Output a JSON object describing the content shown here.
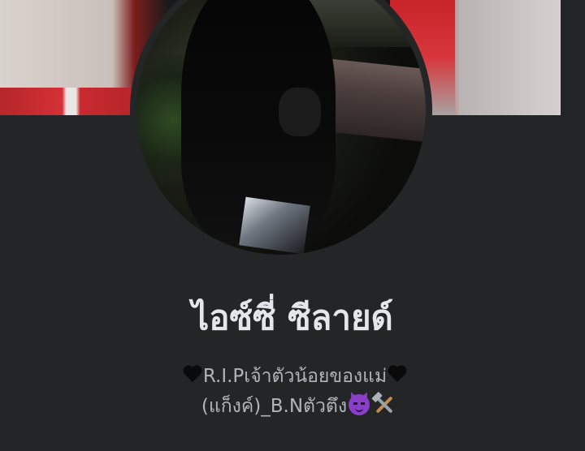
{
  "profile": {
    "name": "ไอซ์ซี่ ซีลายด์",
    "bio_line1": "R.I.Pเจ้าตัวน้อยของแม่",
    "bio_line2": "(แก็งค์)_B.Nตัวตึง"
  },
  "icons": {
    "bio_prefix": "black-heart-icon",
    "bio_suffix": "black-heart-icon",
    "emoji_1": "smiling-devil-icon",
    "emoji_2": "hammer-and-pick-icon"
  },
  "colors": {
    "background": "#242527",
    "name_text": "#e4e6eb",
    "bio_text": "#b0b3b8"
  }
}
